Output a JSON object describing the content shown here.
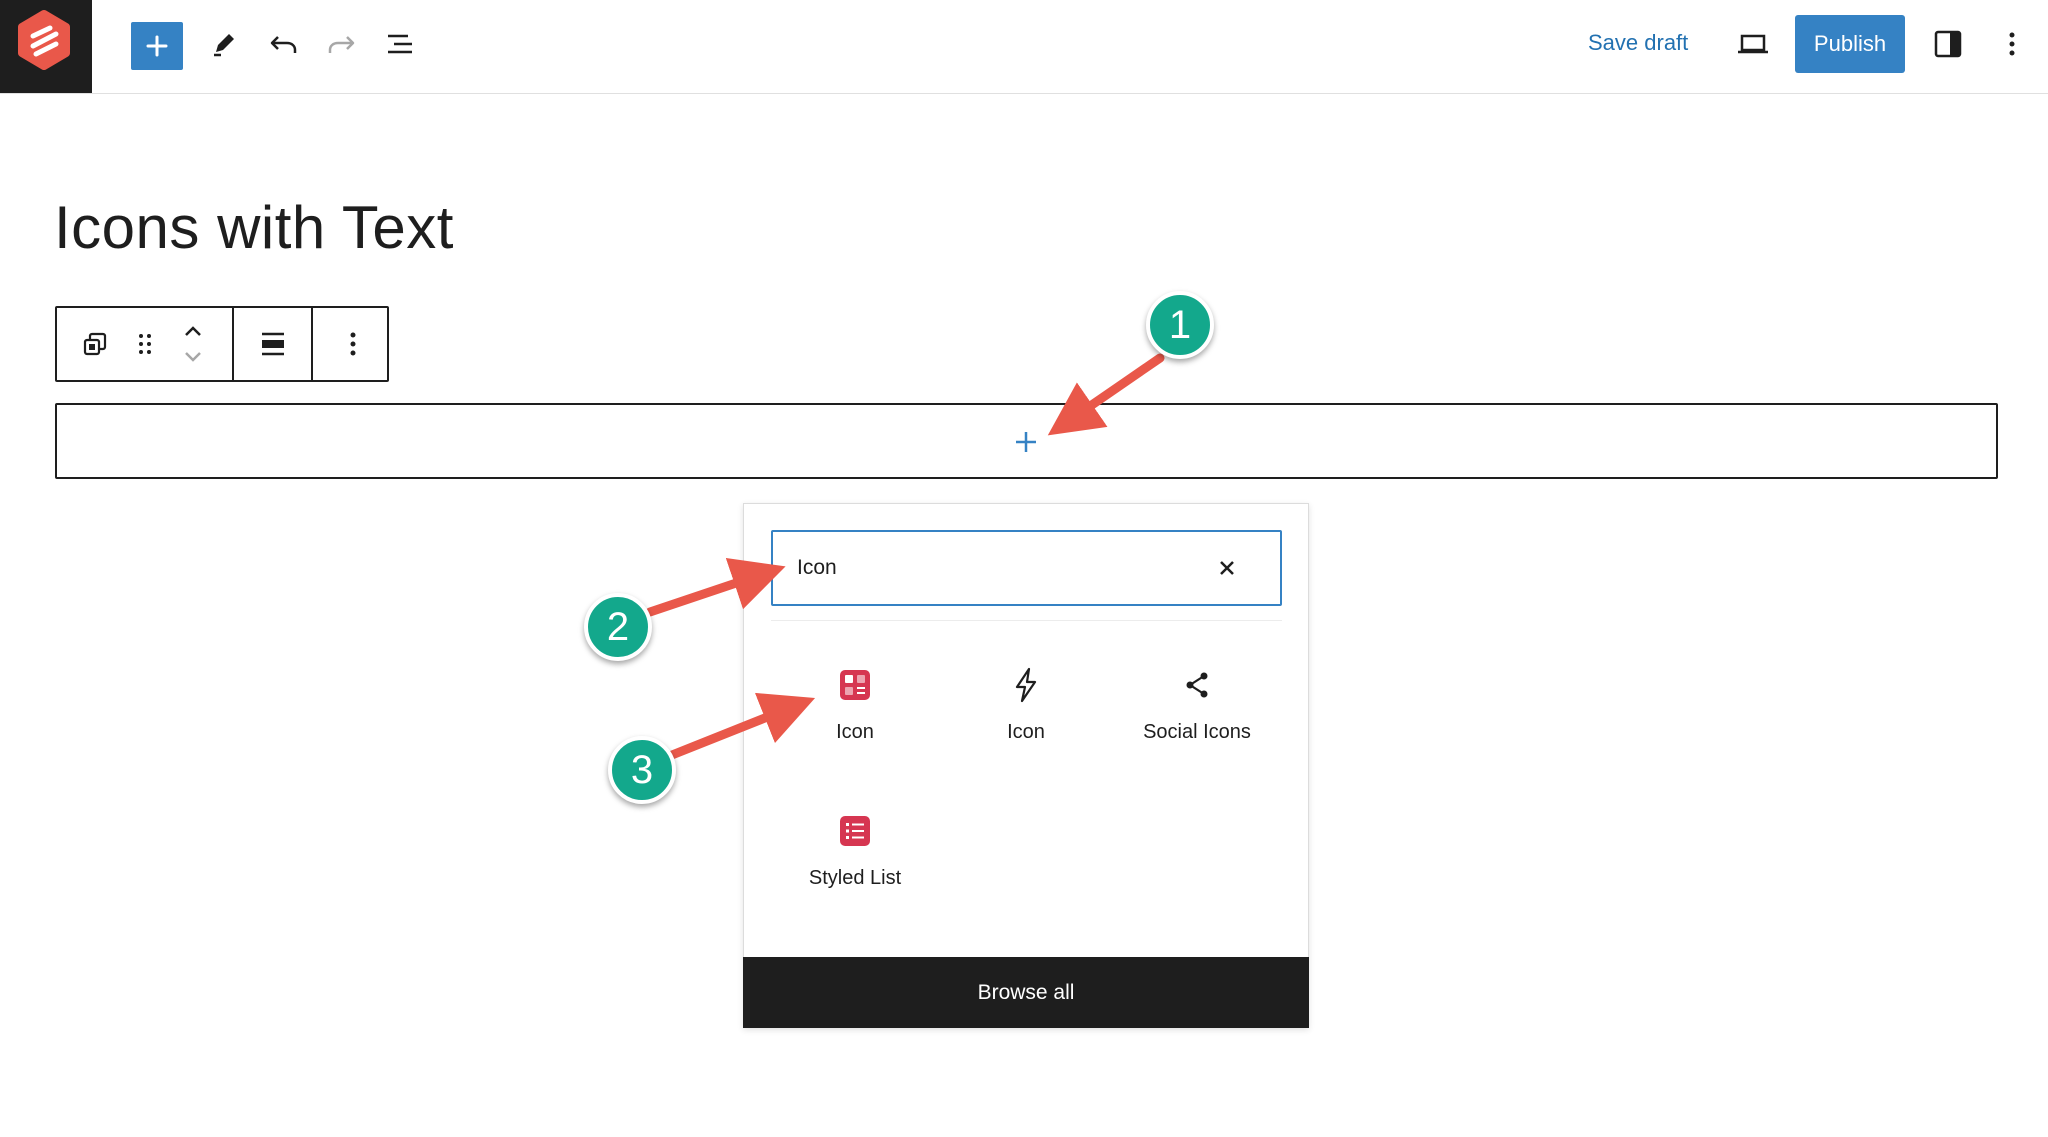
{
  "toolbar": {
    "add_block_icon": "plus-icon",
    "tools_icon": "pencil-icon",
    "undo_icon": "undo-icon",
    "redo_icon": "redo-icon",
    "document_overview_icon": "list-view-icon",
    "save_draft_label": "Save draft",
    "view_icon": "laptop-icon",
    "publish_label": "Publish",
    "settings_icon": "sidebar-panel-icon",
    "options_icon": "vertical-ellipsis-icon"
  },
  "post": {
    "title": "Icons with Text"
  },
  "block_toolbar": {
    "transform_icon": "duplicate-icon",
    "drag_icon": "drag-handle-icon",
    "move_icon": "chevron-up-down-icon",
    "align_icon": "justify-icon",
    "more_icon": "vertical-ellipsis-icon"
  },
  "appender": {
    "icon": "plus-icon"
  },
  "inserter": {
    "search_value": "Icon",
    "clear_icon": "close-icon",
    "results": [
      {
        "label": "Icon",
        "icon": "icon-block-icon"
      },
      {
        "label": "Icon",
        "icon": "lightning-icon"
      },
      {
        "label": "Social Icons",
        "icon": "share-icon"
      },
      {
        "label": "Styled List",
        "icon": "styled-list-icon"
      }
    ],
    "browse_all_label": "Browse all"
  },
  "annotations": {
    "badges": [
      "1",
      "2",
      "3"
    ],
    "badge_color": "#13a88c",
    "arrow_color": "#e9584a"
  },
  "colors": {
    "accent": "#3582c4",
    "dark": "#1e1e1e",
    "block_icon_red": "#d63651"
  }
}
